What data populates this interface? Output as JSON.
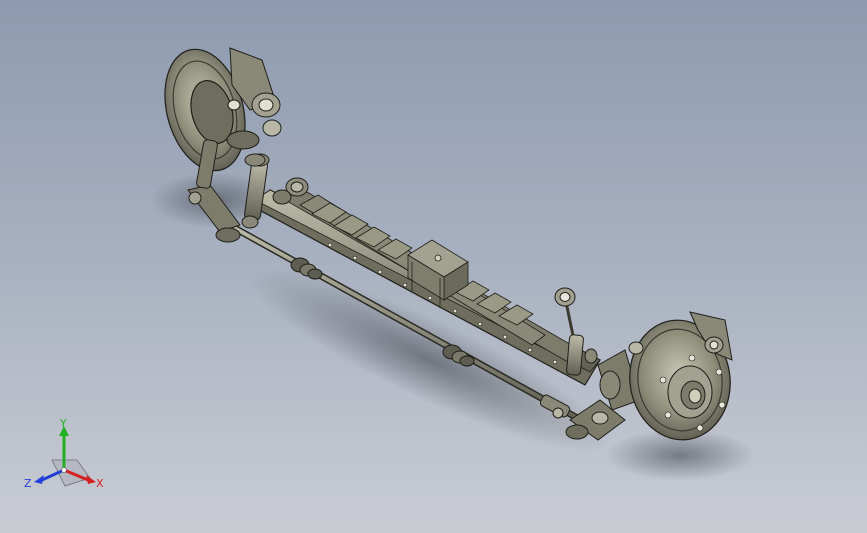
{
  "viewport": {
    "background_top": "#8e9aaf",
    "background_bottom": "#c9ccd3"
  },
  "model": {
    "part_color": "#8a8977",
    "edge_color": "#1f1f1a",
    "highlight_color": "#b9b8a6"
  },
  "triad": {
    "x_label": "X",
    "y_label": "Y",
    "z_label": "Z",
    "x_color": "#d62020",
    "y_color": "#22b022",
    "z_color": "#2540d8"
  }
}
